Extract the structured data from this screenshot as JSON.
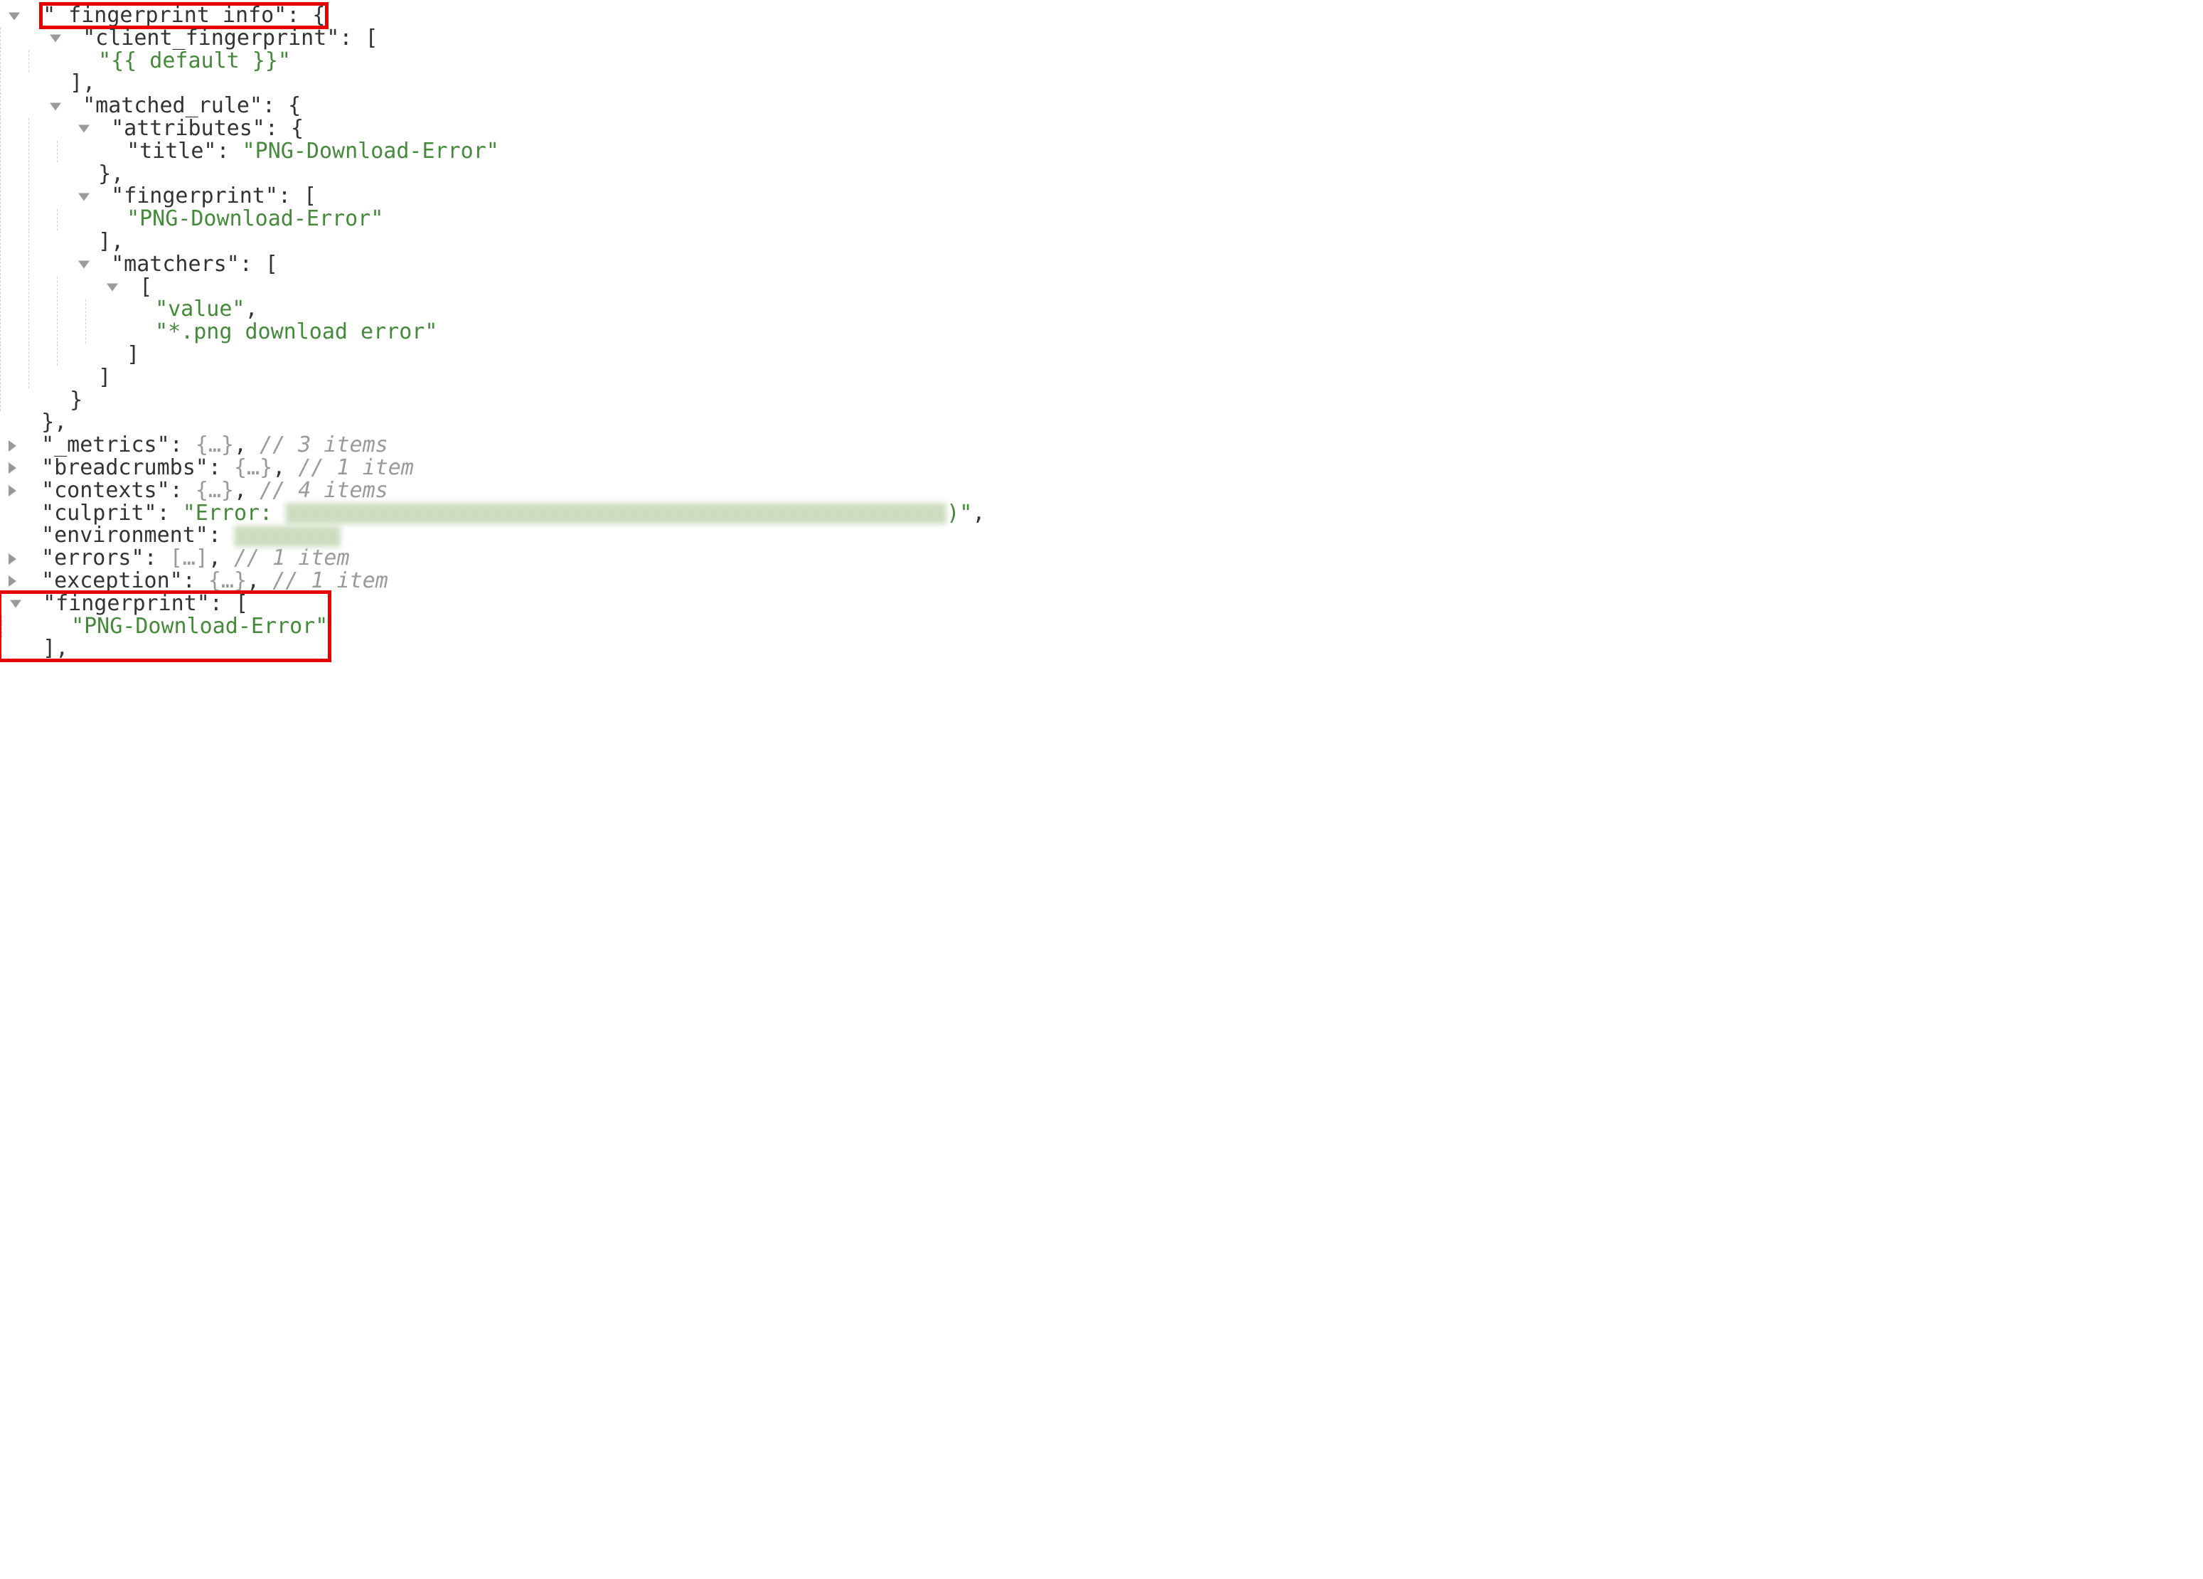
{
  "keys": {
    "fingerprint_info": "\"_fingerprint_info\"",
    "client_fingerprint": "\"client_fingerprint\"",
    "default_tmpl": "\"{{ default }}\"",
    "matched_rule": "\"matched_rule\"",
    "attributes": "\"attributes\"",
    "title": "\"title\"",
    "title_val": "\"PNG-Download-Error\"",
    "fingerprint": "\"fingerprint\"",
    "fingerprint_val": "\"PNG-Download-Error\"",
    "matchers": "\"matchers\"",
    "matcher_key": "\"value\"",
    "matcher_val": "\"*.png download error\"",
    "metrics": "\"_metrics\"",
    "breadcrumbs": "\"breadcrumbs\"",
    "contexts": "\"contexts\"",
    "culprit": "\"culprit\"",
    "culprit_prefix": "\"Error: ",
    "culprit_suffix": ")\"",
    "environment": "\"environment\"",
    "errors": "\"errors\"",
    "exception": "\"exception\"",
    "fp_bottom": "\"fingerprint\"",
    "fp_bottom_val": "\"PNG-Download-Error\""
  },
  "punct": {
    "colon_obrace": ": {",
    "colon_obracket": ": [",
    "colon_sp": ": ",
    "cbracket_comma": "],",
    "cbrace_comma": "},",
    "cbrace": "}",
    "cbracket": "]",
    "comma": ",",
    "obracket": "[",
    "ell_obj": "{…}",
    "ell_arr": "[…]"
  },
  "comments": {
    "items3": "// 3 items",
    "item1": "// 1 item",
    "items4": "// 4 items"
  }
}
